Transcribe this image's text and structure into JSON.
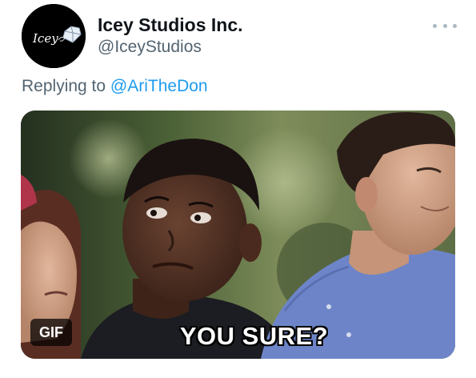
{
  "tweet": {
    "avatar": {
      "icon": "icey-studios-logo",
      "logo_text": "Icey",
      "background": "#000000"
    },
    "author_name": "Icey Studios Inc.",
    "author_handle": "@IceyStudios",
    "reply_prefix": "Replying to",
    "reply_to_handle": "@AriTheDon",
    "more_icon": "more-horizontal-icon",
    "media": {
      "type": "gif",
      "badge_label": "GIF",
      "caption": "YOU SURE?"
    }
  },
  "colors": {
    "text_primary": "#0f1419",
    "text_secondary": "#536471",
    "link": "#1d9bf0",
    "more_icon": "#aab8c2"
  }
}
